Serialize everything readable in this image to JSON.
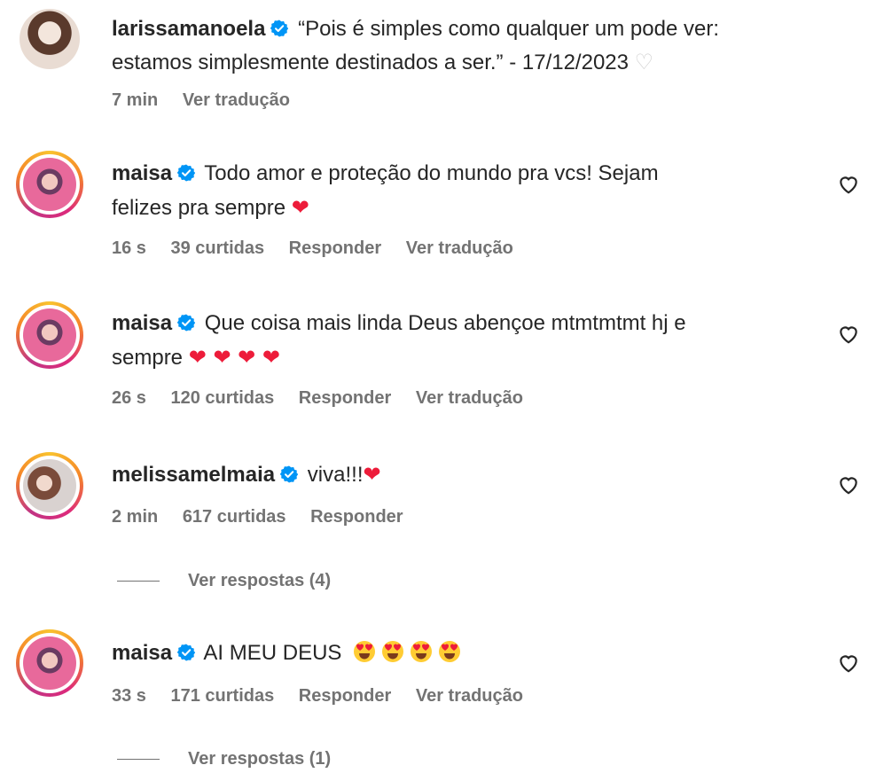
{
  "caption": {
    "username": "larissamanoela",
    "text_line1": "“Pois é simples como qualquer um pode ver:",
    "text_line2": "estamos simplesmente destinados a ser.” - 17/12/2023",
    "time": "7 min",
    "translate": "Ver tradução"
  },
  "comments": [
    {
      "username": "maisa",
      "text_line1": "Todo amor e proteção do mundo pra vcs! Sejam",
      "text_line2": "felizes pra sempre",
      "emoji": "❤",
      "time": "16 s",
      "likes": "39 curtidas",
      "reply": "Responder",
      "translate": "Ver tradução"
    },
    {
      "username": "maisa",
      "text_line1": "Que coisa mais linda Deus abençoe mtmtmtmt hj e",
      "text_line2": "sempre",
      "emoji": "❤ ❤ ❤ ❤",
      "time": "26 s",
      "likes": "120 curtidas",
      "reply": "Responder",
      "translate": "Ver tradução"
    },
    {
      "username": "melissamelmaia",
      "text_line1": "viva!!!",
      "emoji": "❤",
      "time": "2 min",
      "likes": "617 curtidas",
      "reply": "Responder",
      "view_replies": "Ver respostas (4)"
    },
    {
      "username": "maisa",
      "text_line1": "AI MEU DEUS",
      "emoji_name": "smiling-face-with-heart-eyes",
      "time": "33 s",
      "likes": "171 curtidas",
      "reply": "Responder",
      "translate": "Ver tradução",
      "view_replies": "Ver respostas (1)"
    }
  ],
  "colors": {
    "text": "#262626",
    "meta": "#737373",
    "verified": "#0095f6",
    "heart": "#ed1c3a",
    "story_ring": "#dd2a7b"
  }
}
